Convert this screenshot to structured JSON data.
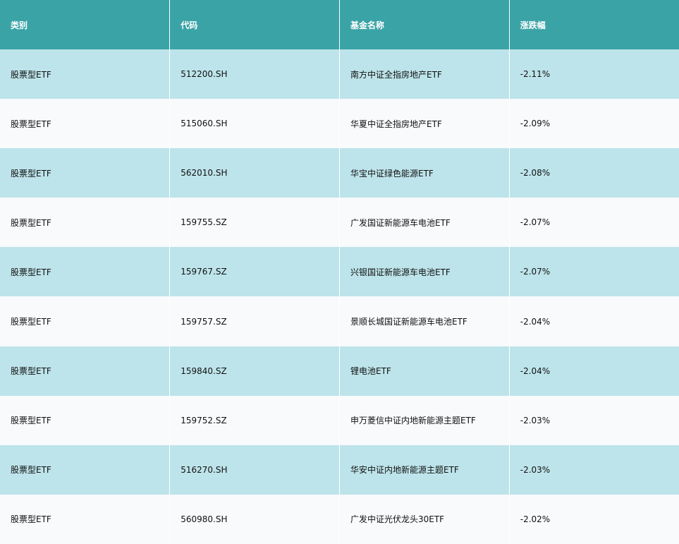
{
  "table": {
    "headers": [
      "类别",
      "代码",
      "基金名称",
      "涨跌幅"
    ],
    "rows": [
      [
        "股票型ETF",
        "512200.SH",
        "南方中证全指房地产ETF",
        "-2.11%"
      ],
      [
        "股票型ETF",
        "515060.SH",
        "华夏中证全指房地产ETF",
        "-2.09%"
      ],
      [
        "股票型ETF",
        "562010.SH",
        "华宝中证绿色能源ETF",
        "-2.08%"
      ],
      [
        "股票型ETF",
        "159755.SZ",
        "广发国证新能源车电池ETF",
        "-2.07%"
      ],
      [
        "股票型ETF",
        "159767.SZ",
        "兴银国证新能源车电池ETF",
        "-2.07%"
      ],
      [
        "股票型ETF",
        "159757.SZ",
        "景顺长城国证新能源车电池ETF",
        "-2.04%"
      ],
      [
        "股票型ETF",
        "159840.SZ",
        "锂电池ETF",
        "-2.04%"
      ],
      [
        "股票型ETF",
        "159752.SZ",
        "申万菱信中证内地新能源主题ETF",
        "-2.03%"
      ],
      [
        "股票型ETF",
        "516270.SH",
        "华安中证内地新能源主题ETF",
        "-2.03%"
      ],
      [
        "股票型ETF",
        "560980.SH",
        "广发中证光伏龙头30ETF",
        "-2.02%"
      ]
    ]
  },
  "colors": {
    "header_bg": "#3aa3a6",
    "row_odd_bg": "#bde4ea",
    "row_even_bg": "#f8fafc"
  }
}
